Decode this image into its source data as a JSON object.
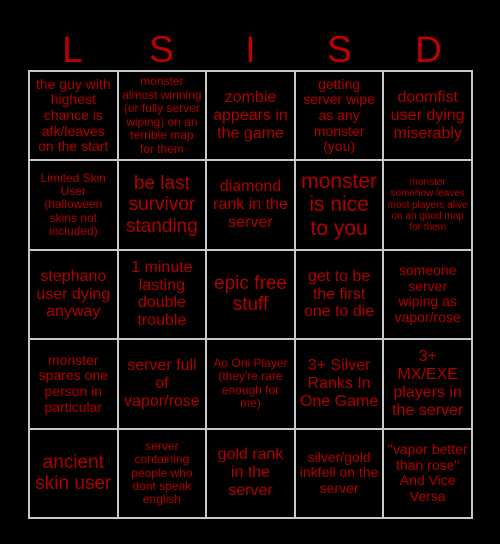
{
  "card": {
    "title_letters": [
      "L",
      "S",
      "I",
      "S",
      "D"
    ],
    "accent_color": "#b00000",
    "header_color": "#c00000",
    "background_color": "#000000",
    "border_color": "#c8c8c8",
    "rows": 5,
    "columns": 5,
    "cells": [
      {
        "text": "the guy with highest chance is afk/leaves on the start",
        "size": "fs-m"
      },
      {
        "text": "monster almost winning (or fully server wiping) on an terrible map for them",
        "size": "fs-s"
      },
      {
        "text": "zombie appears in the game",
        "size": "fs-l"
      },
      {
        "text": "getting server wipe as any monster (you)",
        "size": "fs-m"
      },
      {
        "text": "doomfist user dying miserably",
        "size": "fs-l"
      },
      {
        "text": "Limited Skin User (halloween skins not included)",
        "size": "fs-s"
      },
      {
        "text": "be last survivor standing",
        "size": "fs-xl"
      },
      {
        "text": "diamond rank in the server",
        "size": "fs-l"
      },
      {
        "text": "monster is nice to you",
        "size": "fs-xxl"
      },
      {
        "text": "monster somehow leaves most players alive on an good map for them",
        "size": "fs-xs"
      },
      {
        "text": "stephano user dying anyway",
        "size": "fs-l"
      },
      {
        "text": "1 minute lasting double trouble",
        "size": "fs-l"
      },
      {
        "text": "epic free stuff",
        "size": "fs-xl"
      },
      {
        "text": "get to be the first one to die",
        "size": "fs-l"
      },
      {
        "text": "someone server wiping as vapor/rose",
        "size": "fs-m"
      },
      {
        "text": "monster spares one person in particular",
        "size": "fs-m"
      },
      {
        "text": "server full of vapor/rose",
        "size": "fs-l"
      },
      {
        "text": "Ao Oni Player (they're rare enough for me)",
        "size": "fs-s"
      },
      {
        "text": "3+ Silver Ranks In One Game",
        "size": "fs-l"
      },
      {
        "text": "3+ MX/EXE players in the server",
        "size": "fs-l"
      },
      {
        "text": "ancient skin user",
        "size": "fs-xl"
      },
      {
        "text": "server containing people who dont speak english",
        "size": "fs-s"
      },
      {
        "text": "gold rank in the server",
        "size": "fs-l"
      },
      {
        "text": "silver/gold inkfell on the server",
        "size": "fs-m"
      },
      {
        "text": "\"vapor better than rose\" And Vice Versa",
        "size": "fs-m"
      }
    ]
  }
}
